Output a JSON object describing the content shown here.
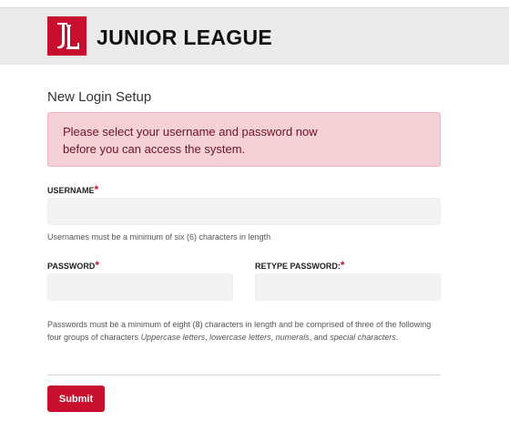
{
  "header": {
    "brand": "JUNIOR LEAGUE",
    "logo_icon": "junior-league-logo",
    "logo_letters": "JL",
    "brand_color": "#c8102e"
  },
  "form": {
    "title": "New Login Setup",
    "alert": "Please select your username and password now before you can access the system.",
    "username": {
      "label": "USERNAME",
      "required_mark": "*",
      "value": "",
      "placeholder": "",
      "help": "Usernames must be a minimum of six (6) characters in length"
    },
    "password": {
      "label": "PASSWORD",
      "required_mark": "*",
      "value": "",
      "placeholder": ""
    },
    "retype_password": {
      "label": "RETYPE PASSWORD:",
      "required_mark": "*",
      "value": "",
      "placeholder": ""
    },
    "password_help": {
      "intro": "Passwords must be a minimum of eight (8) characters in length and be comprised of three of the following four groups of characters ",
      "group1": "Uppercase letters",
      "sep1": ", ",
      "group2": "lowercase letters",
      "sep2": ", ",
      "group3": "numerals",
      "sep3": ", and ",
      "group4": "special characters",
      "end": "."
    },
    "submit_label": "Submit"
  }
}
